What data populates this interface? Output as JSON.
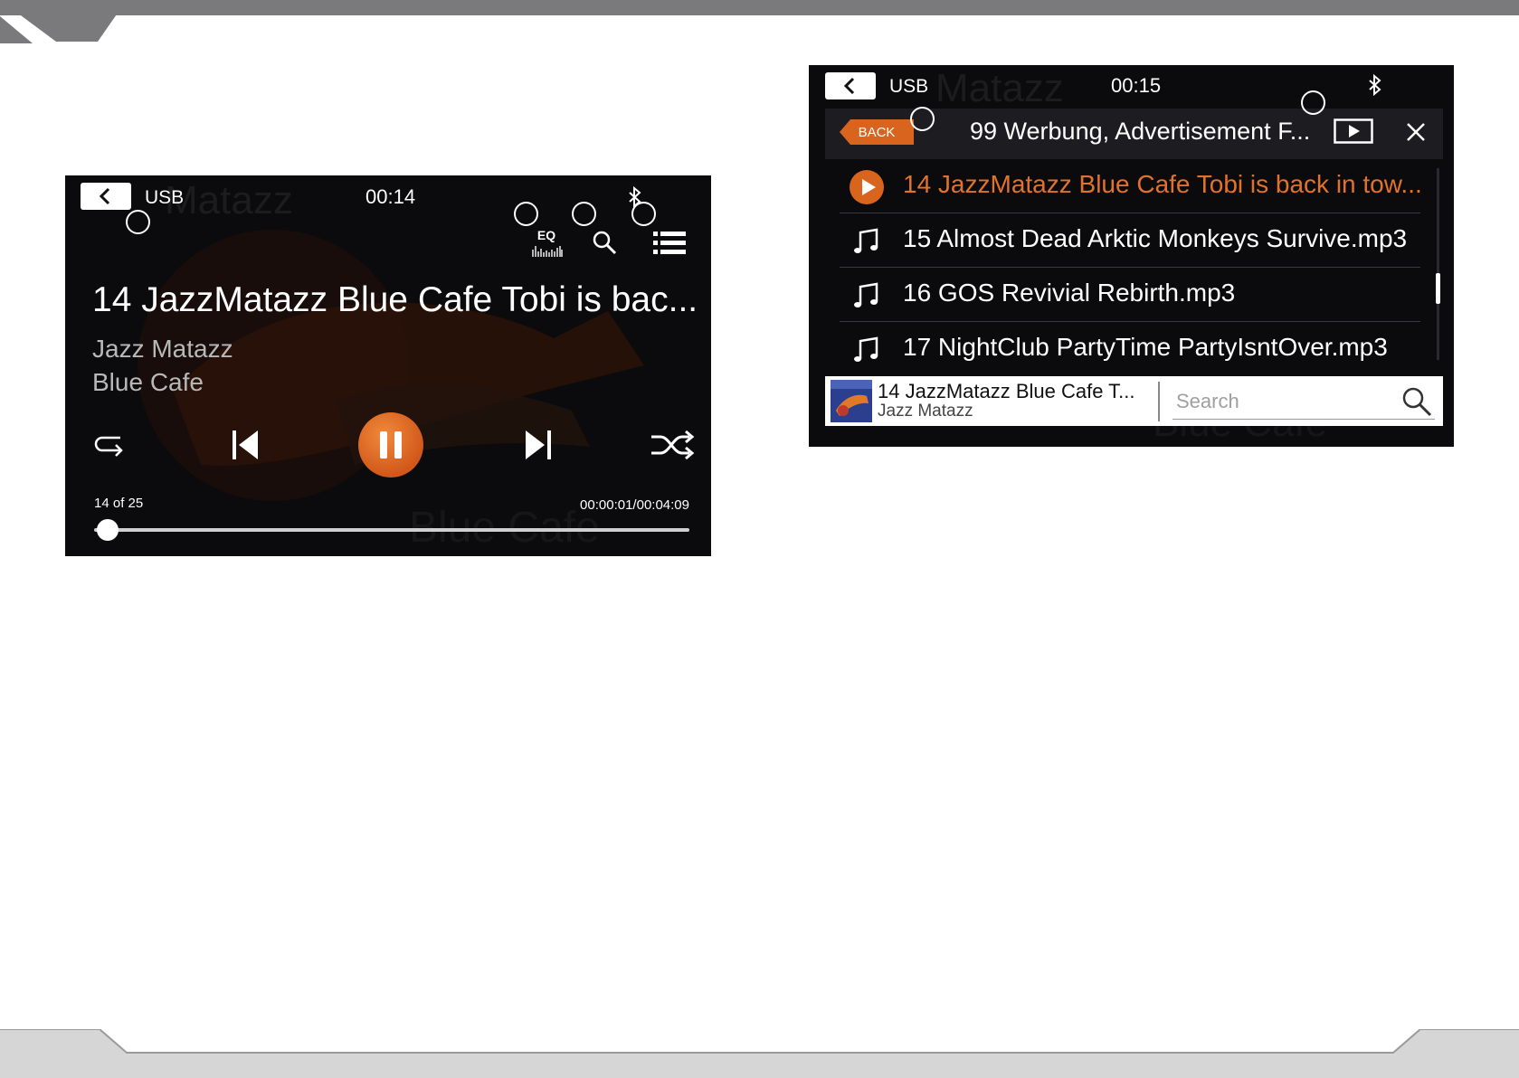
{
  "player_screen": {
    "source": "USB",
    "clock": "00:14",
    "eq_label": "EQ",
    "track_title": "14 JazzMatazz Blue Cafe Tobi is bac...",
    "artist": "Jazz Matazz",
    "album": "Blue Cafe",
    "track_count": "14 of 25",
    "time_readout": "00:00:01/00:04:09",
    "progress_fraction": 0.004,
    "icons": [
      "back-icon",
      "eq-icon",
      "search-icon",
      "list-icon",
      "bluetooth-icon",
      "repeat-icon",
      "previous-icon",
      "pause-icon",
      "next-icon",
      "shuffle-icon"
    ]
  },
  "list_screen": {
    "source": "USB",
    "clock": "00:15",
    "back_label": "BACK",
    "folder_title": "99 Werbung, Advertisement F...",
    "files": [
      {
        "name": "14 JazzMatazz Blue Cafe Tobi is back in tow...",
        "playing": true
      },
      {
        "name": "15 Almost Dead Arktic Monkeys Survive.mp3",
        "playing": false
      },
      {
        "name": "16 GOS Revivial Rebirth.mp3",
        "playing": false
      },
      {
        "name": "17 NightClub PartyTime PartyIsntOver.mp3",
        "playing": false
      }
    ],
    "now_playing_title": "14 JazzMatazz Blue Cafe T...",
    "now_playing_artist": "Jazz Matazz",
    "search_placeholder": "Search"
  },
  "colors": {
    "accent": "#d8641e",
    "screen_bg": "#0b0b0d",
    "page_bg": "#ffffff"
  }
}
